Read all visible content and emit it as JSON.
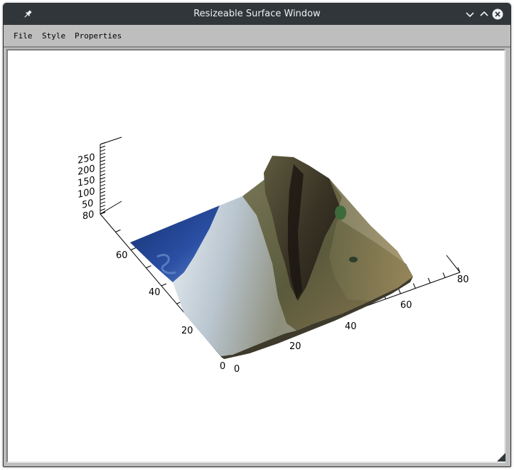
{
  "window": {
    "title": "Resizeable Surface Window"
  },
  "titlebar_icons": [
    "pin-icon",
    "minimize-chevron-icon",
    "maximize-chevron-icon",
    "close-icon"
  ],
  "menu": {
    "file": "File",
    "style": "Style",
    "properties": "Properties"
  },
  "chart_data": {
    "type": "surface",
    "z_axis": {
      "range": [
        0,
        250
      ],
      "ticks": [
        "80",
        "50",
        "100",
        "150",
        "200",
        "250"
      ]
    },
    "y_axis": {
      "range": [
        0,
        80
      ],
      "ticks": [
        "0",
        "20",
        "40",
        "60"
      ]
    },
    "x_axis": {
      "range": [
        0,
        80
      ],
      "ticks": [
        "0",
        "20",
        "40",
        "60",
        "80"
      ]
    },
    "texture": "satellite image with coastal city, sea on the left and mountain ridge",
    "colors": {
      "sea": "#1f3f9a",
      "sea_light": "#3f66b8",
      "urban": "#c9d3dc",
      "veg": "#5b6a3a",
      "ridge": "#3c3424"
    }
  }
}
